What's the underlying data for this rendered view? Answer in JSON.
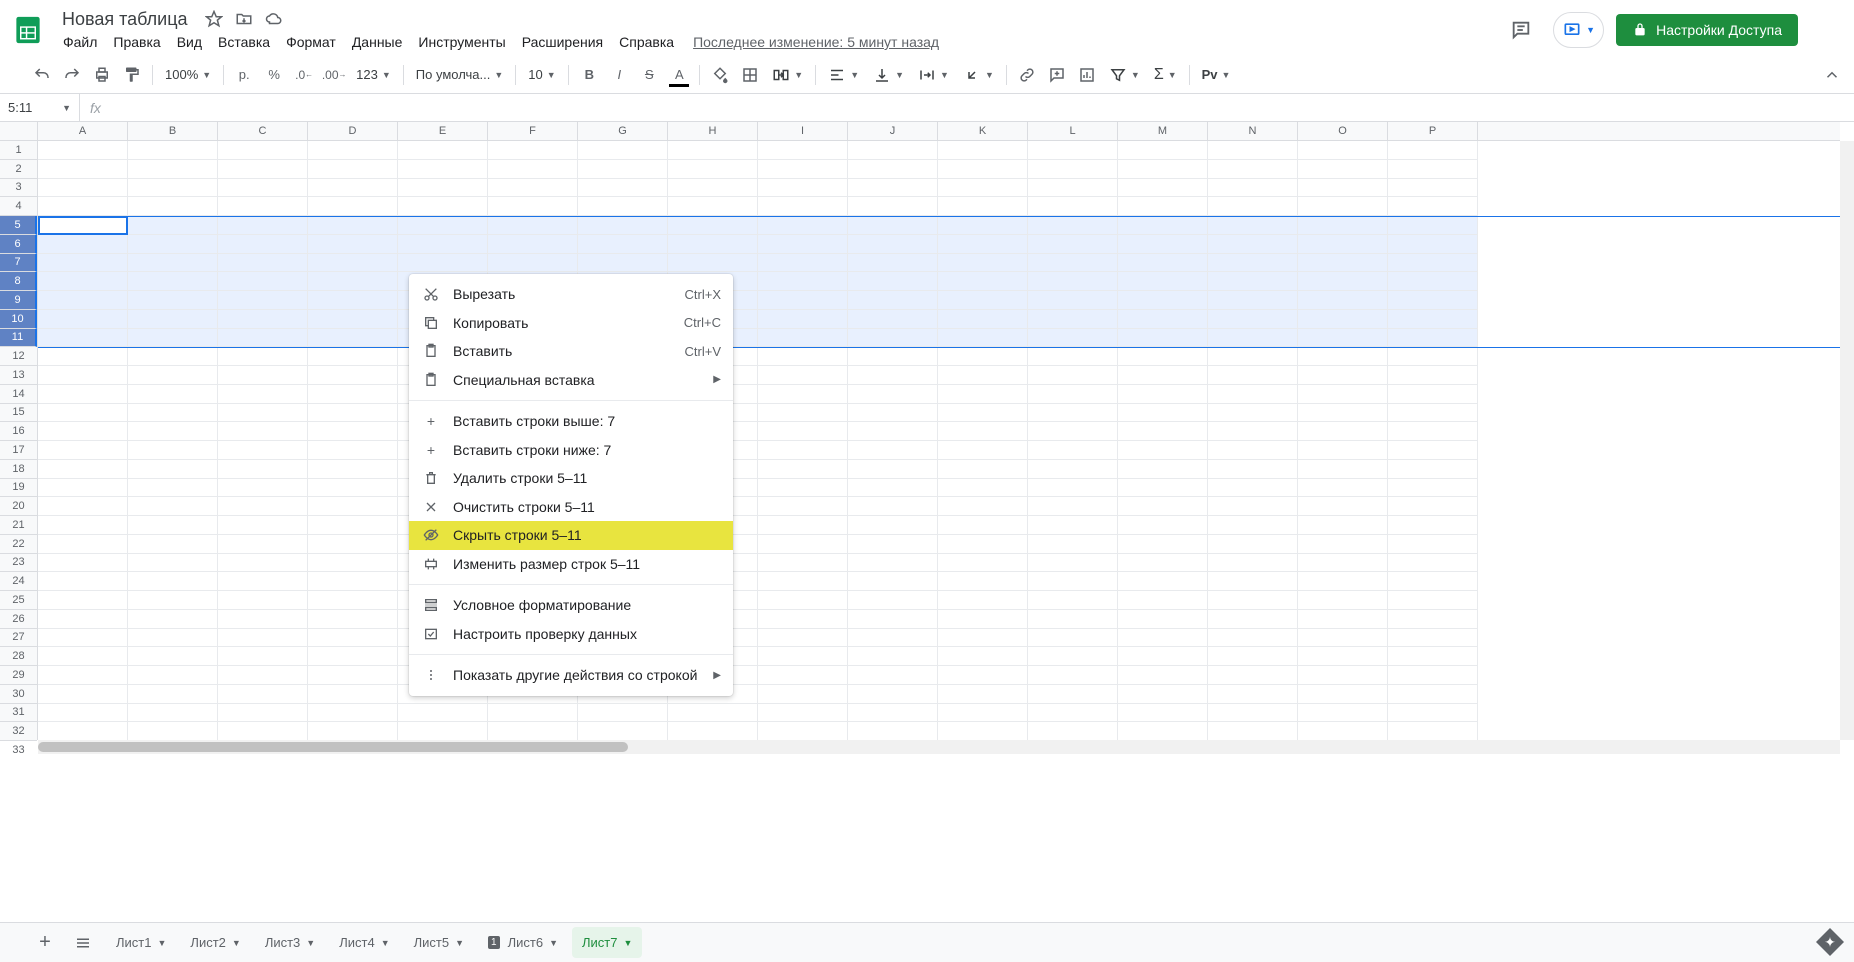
{
  "doc": {
    "title": "Новая таблица"
  },
  "menus": [
    "Файл",
    "Правка",
    "Вид",
    "Вставка",
    "Формат",
    "Данные",
    "Инструменты",
    "Расширения",
    "Справка"
  ],
  "last_edit": "Последнее изменение: 5 минут назад",
  "share_label": "Настройки Доступа",
  "toolbar": {
    "zoom": "100%",
    "currency": "р.",
    "percent": "%",
    "more_formats": "123",
    "font": "По умолча...",
    "font_size": "10",
    "pivoter": "Pv"
  },
  "name_box": "5:11",
  "columns": [
    "A",
    "B",
    "C",
    "D",
    "E",
    "F",
    "G",
    "H",
    "I",
    "J",
    "K",
    "L",
    "M",
    "N",
    "O",
    "P"
  ],
  "row_count": 33,
  "sel_rows": {
    "start": 5,
    "end": 11
  },
  "context_menu": {
    "cut": "Вырезать",
    "cut_sc": "Ctrl+X",
    "copy": "Копировать",
    "copy_sc": "Ctrl+C",
    "paste": "Вставить",
    "paste_sc": "Ctrl+V",
    "paste_special": "Специальная вставка",
    "insert_above": "Вставить строки выше: 7",
    "insert_below": "Вставить строки ниже: 7",
    "delete_rows": "Удалить строки 5–11",
    "clear_rows": "Очистить строки 5–11",
    "hide_rows": "Скрыть строки 5–11",
    "resize_rows": "Изменить размер строк 5–11",
    "cond_format": "Условное форматирование",
    "data_valid": "Настроить проверку данных",
    "more_actions": "Показать другие действия со строкой"
  },
  "sheets": [
    {
      "name": "Лист1",
      "active": false
    },
    {
      "name": "Лист2",
      "active": false
    },
    {
      "name": "Лист3",
      "active": false
    },
    {
      "name": "Лист4",
      "active": false
    },
    {
      "name": "Лист5",
      "active": false
    },
    {
      "name": "Лист6",
      "active": false,
      "badge": "1"
    },
    {
      "name": "Лист7",
      "active": true
    }
  ]
}
